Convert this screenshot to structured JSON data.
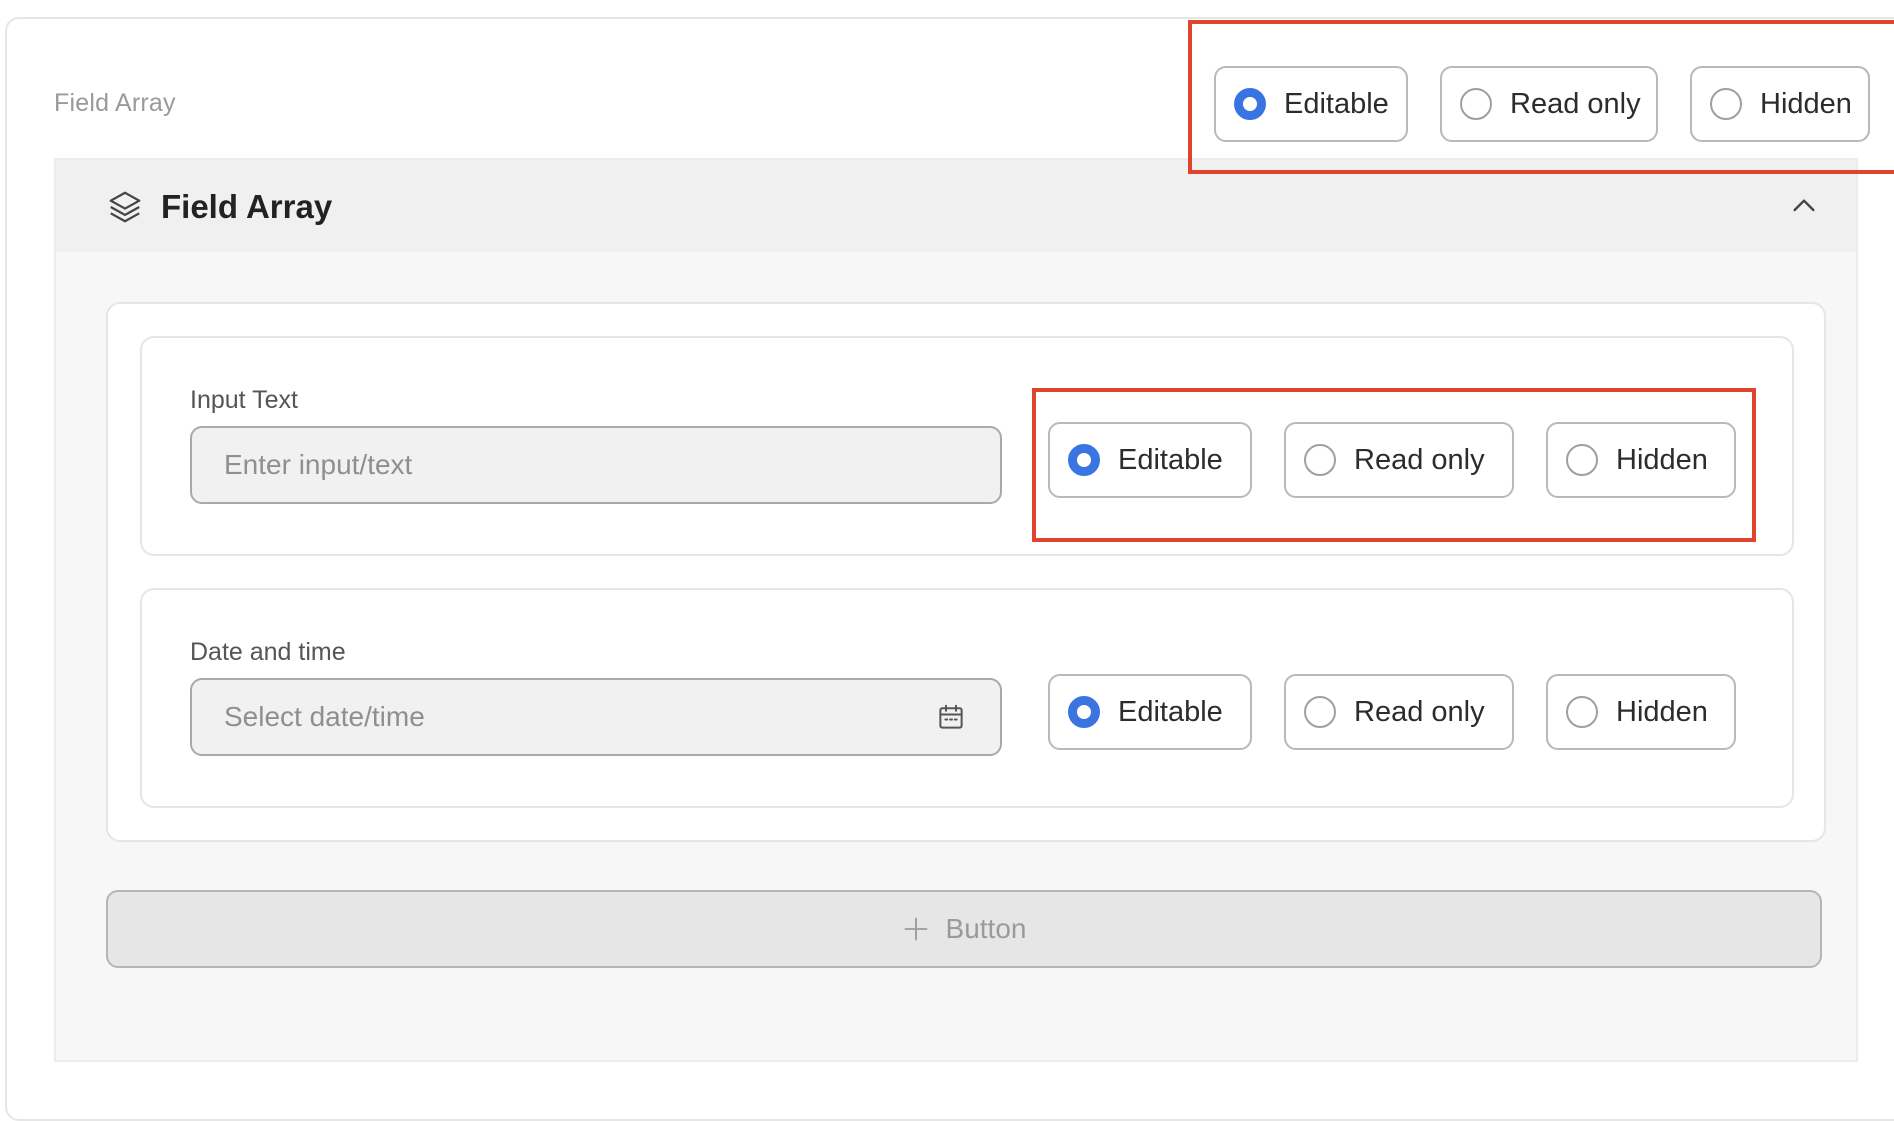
{
  "section": {
    "label": "Field Array"
  },
  "top_visibility": {
    "options": [
      {
        "label": "Editable",
        "checked": true
      },
      {
        "label": "Read only",
        "checked": false
      },
      {
        "label": "Hidden",
        "checked": false
      }
    ]
  },
  "panel": {
    "title": "Field Array",
    "icon": "layers-icon",
    "collapse_icon": "chevron-up-icon"
  },
  "fields": [
    {
      "label": "Input Text",
      "placeholder": "Enter input/text",
      "value": "",
      "options": [
        {
          "label": "Editable",
          "checked": true
        },
        {
          "label": "Read only",
          "checked": false
        },
        {
          "label": "Hidden",
          "checked": false
        }
      ]
    },
    {
      "label": "Date and time",
      "placeholder": "Select date/time",
      "value": "",
      "icon": "calendar-icon",
      "options": [
        {
          "label": "Editable",
          "checked": true
        },
        {
          "label": "Read only",
          "checked": false
        },
        {
          "label": "Hidden",
          "checked": false
        }
      ]
    }
  ],
  "add_button": {
    "label": "Button",
    "icon": "plus-icon"
  },
  "colors": {
    "accent": "#3a74e0",
    "highlight": "#e0432e"
  }
}
